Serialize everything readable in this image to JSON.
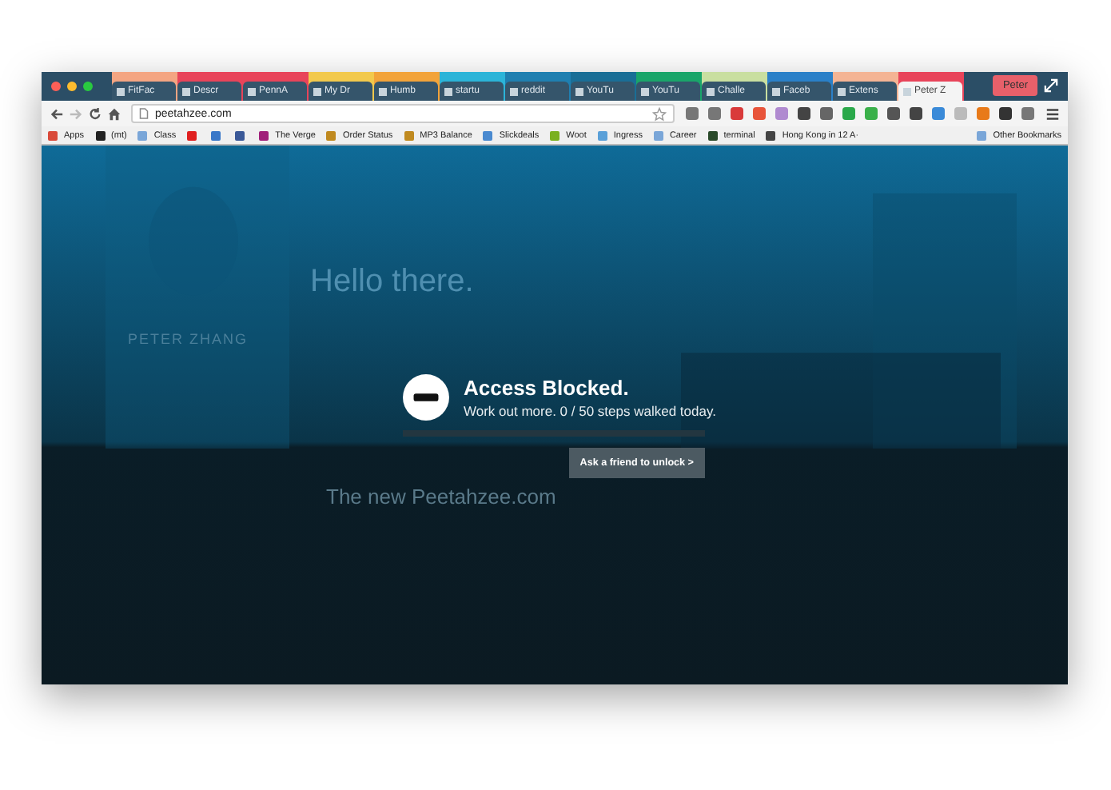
{
  "tabs": [
    {
      "label": "FitFac",
      "selected": false,
      "color": "#f4a582"
    },
    {
      "label": "Descr",
      "selected": false,
      "color": "#e8445a"
    },
    {
      "label": "PennA",
      "selected": false,
      "color": "#e8445a"
    },
    {
      "label": "My Dr",
      "selected": false,
      "color": "#f2c94c"
    },
    {
      "label": "Humb",
      "selected": false,
      "color": "#f2a33a"
    },
    {
      "label": "startu",
      "selected": false,
      "color": "#2bb4d8"
    },
    {
      "label": "reddit",
      "selected": false,
      "color": "#1f7fb0"
    },
    {
      "label": "YouTu",
      "selected": false,
      "color": "#1a6e96"
    },
    {
      "label": "YouTu",
      "selected": false,
      "color": "#1aa56a"
    },
    {
      "label": "Challe",
      "selected": false,
      "color": "#c9dfa0"
    },
    {
      "label": "Faceb",
      "selected": false,
      "color": "#2a80c8"
    },
    {
      "label": "Extens",
      "selected": false,
      "color": "#f4b494"
    },
    {
      "label": "Peter Z",
      "selected": true,
      "color": "#e8445a"
    }
  ],
  "profile": {
    "label": "Peter"
  },
  "address": {
    "url": "peetahzee.com"
  },
  "extensions": [
    {
      "color": "#777777"
    },
    {
      "color": "#777777"
    },
    {
      "color": "#d93a3a"
    },
    {
      "color": "#e8543a"
    },
    {
      "color": "#b08ad0"
    },
    {
      "color": "#444444"
    },
    {
      "color": "#666666"
    },
    {
      "color": "#2aa84a"
    },
    {
      "color": "#3ab04a"
    },
    {
      "color": "#555555"
    },
    {
      "color": "#444444"
    },
    {
      "color": "#3a8ad8"
    },
    {
      "color": "#bbbbbb"
    },
    {
      "color": "#e87a1a"
    },
    {
      "color": "#333333"
    },
    {
      "color": "#777777"
    }
  ],
  "bookmarks": [
    {
      "label": "Apps",
      "color": "#d94a3a"
    },
    {
      "label": "(mt)",
      "color": "#222222"
    },
    {
      "label": "Class",
      "color": "#7aa6d8"
    },
    {
      "color": "#e02020"
    },
    {
      "color": "#3a78c8"
    },
    {
      "color": "#3b5998"
    },
    {
      "label": "The Verge",
      "color": "#a0207a"
    },
    {
      "label": "Order Status",
      "color": "#c08a20"
    },
    {
      "label": "MP3 Balance",
      "color": "#c08a20"
    },
    {
      "label": "Slickdeals",
      "color": "#4a8ad0"
    },
    {
      "label": "Woot",
      "color": "#7ab020"
    },
    {
      "label": "Ingress",
      "color": "#5aa0d8"
    },
    {
      "label": "Career",
      "color": "#7aa6d8"
    },
    {
      "label": "terminal",
      "color": "#2a4a2a"
    },
    {
      "label": "Hong Kong in 12 A·",
      "color": "#444444"
    }
  ],
  "other_bookmarks": {
    "label": "Other Bookmarks"
  },
  "page": {
    "greeting": "Hello there.",
    "name": "PETER ZHANG",
    "heading": "The new Peetahzee.com"
  },
  "block": {
    "title": "Access Blocked.",
    "message": "Work out more. 0 / 50 steps walked today.",
    "level": 0,
    "button": "Ask a friend to unlock >"
  }
}
